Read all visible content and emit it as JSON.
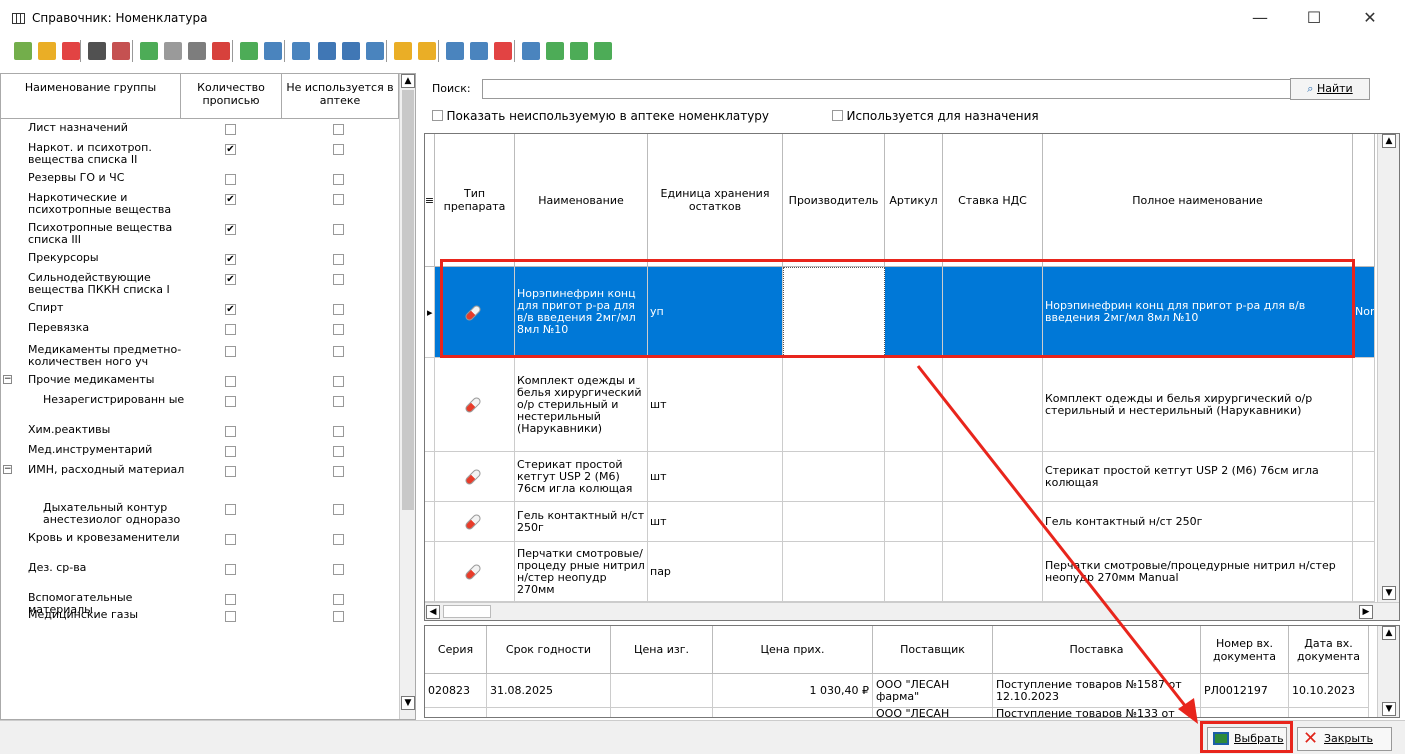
{
  "window": {
    "title": "Справочник: Номенклатура",
    "minimize": "—",
    "maximize": "☐",
    "close": "✕"
  },
  "toolbar": {
    "icons": [
      "add-group-icon",
      "add-folder-icon",
      "delete-group-icon",
      "sort-icon",
      "filter-off-icon",
      "add-icon",
      "copy-icon",
      "edit-icon",
      "delete-icon",
      "refresh-icon",
      "filter-icon",
      "import-icon",
      "arrow-left-icon",
      "arrow-right-icon",
      "export-icon",
      "star-add-icon",
      "star-icon",
      "filter-set-icon",
      "filter-edit-icon",
      "filter-clear-icon",
      "print-icon",
      "excel-icon",
      "report-icon",
      "report2-icon"
    ]
  },
  "left_panel": {
    "headers": [
      "Наименование группы",
      "Количество прописью",
      "Не используется в аптеке"
    ],
    "rows": [
      {
        "label": "Лист назначений",
        "qty": false,
        "unused": false,
        "level": 1
      },
      {
        "label": "Наркот. и психотроп. вещества списка II",
        "qty": true,
        "unused": false,
        "level": 1
      },
      {
        "label": "Резервы ГО и ЧС",
        "qty": false,
        "unused": false,
        "level": 1
      },
      {
        "label": "Наркотические и психотропные вещества",
        "qty": true,
        "unused": false,
        "level": 1
      },
      {
        "label": "Психотропные вещества списка III",
        "qty": true,
        "unused": false,
        "level": 1
      },
      {
        "label": "Прекурсоры",
        "qty": true,
        "unused": false,
        "level": 1
      },
      {
        "label": "Сильнодействующие вещества ПККН списка I",
        "qty": true,
        "unused": false,
        "level": 1
      },
      {
        "label": "Спирт",
        "qty": true,
        "unused": false,
        "level": 1
      },
      {
        "label": "Перевязка",
        "qty": false,
        "unused": false,
        "level": 1
      },
      {
        "label": "Медикаменты предметно-количествен ного уч",
        "qty": false,
        "unused": false,
        "level": 1
      },
      {
        "label": "Прочие медикаменты",
        "qty": false,
        "unused": false,
        "level": 1,
        "expander": "−"
      },
      {
        "label": "Незарегистрированн ые",
        "qty": false,
        "unused": false,
        "level": 2
      },
      {
        "label": "Хим.реактивы",
        "qty": false,
        "unused": false,
        "level": 1
      },
      {
        "label": "Мед.инструментарий",
        "qty": false,
        "unused": false,
        "level": 1
      },
      {
        "label": "ИМН, расходный материал",
        "qty": false,
        "unused": false,
        "level": 1,
        "expander": "−"
      },
      {
        "label": "Дыхательный контур анестезиолог одноразо",
        "qty": false,
        "unused": false,
        "level": 2
      },
      {
        "label": "Кровь и кровезаменители",
        "qty": false,
        "unused": false,
        "level": 1
      },
      {
        "label": "Дез. ср-ва",
        "qty": false,
        "unused": false,
        "level": 1
      },
      {
        "label": "Вспомогательные материалы",
        "qty": false,
        "unused": false,
        "level": 1
      },
      {
        "label": "Медицинские газы",
        "qty": false,
        "unused": false,
        "level": 1
      }
    ]
  },
  "search": {
    "label": "Поиск:",
    "value": "",
    "find_button": "Найти",
    "opt_unused": "Показать неиспользуемую в аптеке номенклатуру",
    "opt_assign": "Используется для назначения"
  },
  "main_grid": {
    "columns": [
      "Тип препарата",
      "Наименование",
      "Единица хранения остатков",
      "Производитель",
      "Артикул",
      "Ставка НДС",
      "Полное наименование"
    ],
    "rows": [
      {
        "name": "Норэпинефрин конц для пригот р-ра для в/в введения 2мг/мл 8мл №10",
        "unit": "уп",
        "full": "Норэпинефрин конц для пригот р-ра для в/в введения 2мг/мл 8мл №10",
        "extra": "Nor"
      },
      {
        "name": "Комплект одежды и белья хирургический о/р стерильный и нестерильный (Нарукавники)",
        "unit": "шт",
        "full": "Комплект одежды и белья хирургический о/р стерильный и нестерильный (Нарукавники)",
        "extra": ""
      },
      {
        "name": "Стерикат простой кетгут USP 2 (М6) 76см игла колющая",
        "unit": "шт",
        "full": "Стерикат простой кетгут USP 2 (М6) 76см игла колющая",
        "extra": ""
      },
      {
        "name": "Гель контактный н/ст 250г",
        "unit": "шт",
        "full": "Гель контактный н/ст 250г",
        "extra": ""
      },
      {
        "name": "Перчатки смотровые/процеду рные нитрил н/стер неопудр 270мм",
        "unit": "пар",
        "full": "Перчатки смотровые/процедурные нитрил н/стер неопудр 270мм Manual",
        "extra": ""
      }
    ]
  },
  "lower_grid": {
    "columns": [
      "Серия",
      "Срок годности",
      "Цена изг.",
      "Цена прих.",
      "Поставщик",
      "Поставка",
      "Номер вх. документа",
      "Дата вх. документа"
    ],
    "rows": [
      {
        "series": "020823",
        "expiry": "31.08.2025",
        "price_mfr": "",
        "price_in": "1 030,40 ₽",
        "supplier": "ООО \"ЛЕСАН фарма\"",
        "delivery": "Поступление товаров №1587 от 12.10.2023",
        "doc_no": "РЛ0012197",
        "doc_date": "10.10.2023"
      },
      {
        "series": "",
        "expiry": "",
        "price_mfr": "",
        "price_in": "",
        "supplier": "ООО \"ЛЕСАН",
        "delivery": "Поступление товаров №133 от",
        "doc_no": "",
        "doc_date": ""
      }
    ]
  },
  "buttons": {
    "select": "Выбрать",
    "close": "Закрыть"
  },
  "colors": {
    "selection": "#0078d7",
    "highlight": "#e8251c"
  }
}
